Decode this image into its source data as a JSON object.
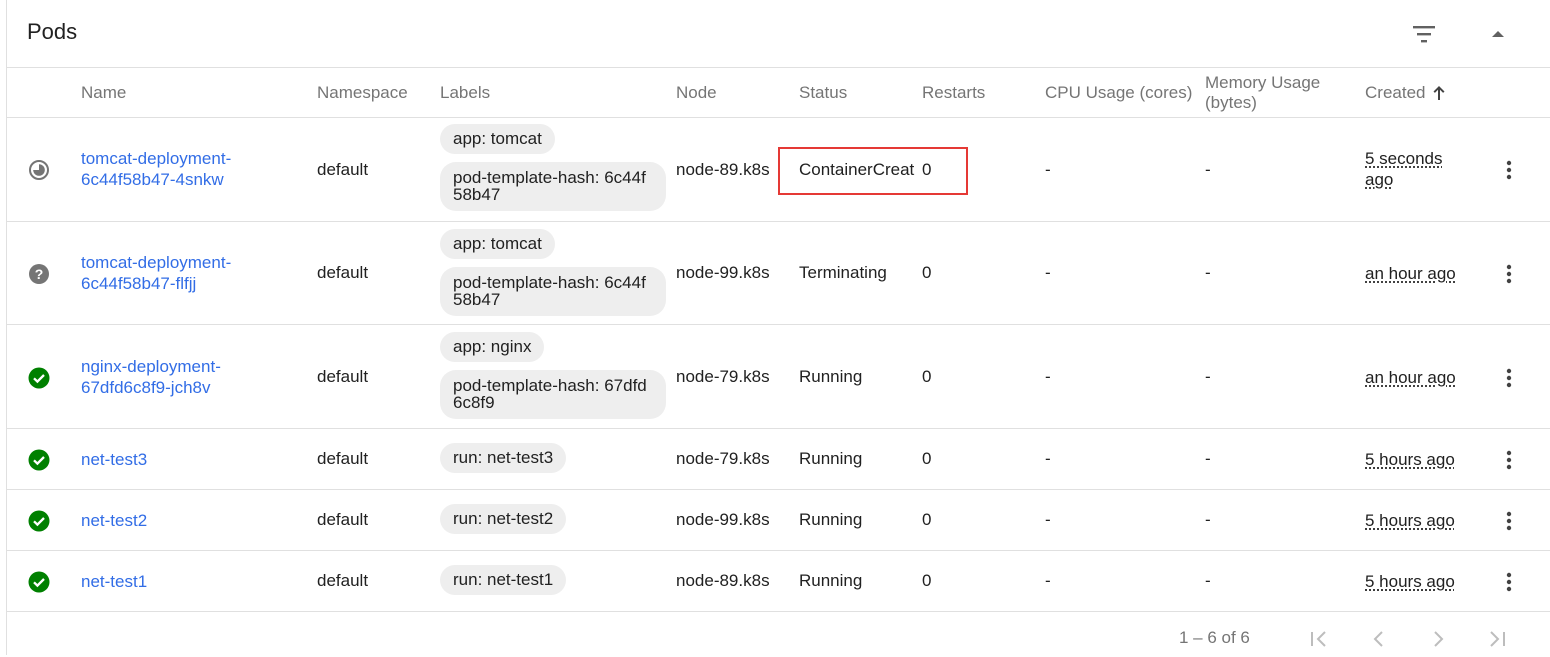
{
  "header": {
    "title": "Pods"
  },
  "columns": {
    "name": "Name",
    "namespace": "Namespace",
    "labels": "Labels",
    "node": "Node",
    "status": "Status",
    "restarts": "Restarts",
    "cpu": "CPU Usage (cores)",
    "memory_line1": "Memory Usage",
    "memory_line2": "(bytes)",
    "created": "Created",
    "created_sort_icon": "arrow-up-icon"
  },
  "rows": [
    {
      "status_icon": "pending-icon",
      "name_line1": "tomcat-deployment-",
      "name_line2": "6c44f58b47-4snkw",
      "namespace": "default",
      "labels": [
        "app: tomcat",
        "pod-template-hash: 6c44f58b47"
      ],
      "node": "node-89.k8s",
      "status": "ContainerCreat",
      "restarts": "0",
      "cpu": "-",
      "memory": "-",
      "created_line1": "5 seconds",
      "created_line2": "ago"
    },
    {
      "status_icon": "unknown-icon",
      "name_line1": "tomcat-deployment-",
      "name_line2": "6c44f58b47-flfjj",
      "namespace": "default",
      "labels": [
        "app: tomcat",
        "pod-template-hash: 6c44f58b47"
      ],
      "node": "node-99.k8s",
      "status": "Terminating",
      "restarts": "0",
      "cpu": "-",
      "memory": "-",
      "created_line1": "an hour ago",
      "created_line2": ""
    },
    {
      "status_icon": "check-circle-icon",
      "name_line1": "nginx-deployment-",
      "name_line2": "67dfd6c8f9-jch8v",
      "namespace": "default",
      "labels": [
        "app: nginx",
        "pod-template-hash: 67dfd6c8f9"
      ],
      "node": "node-79.k8s",
      "status": "Running",
      "restarts": "0",
      "cpu": "-",
      "memory": "-",
      "created_line1": "an hour ago",
      "created_line2": ""
    },
    {
      "status_icon": "check-circle-icon",
      "name_line1": "net-test3",
      "name_line2": "",
      "namespace": "default",
      "labels": [
        "run: net-test3"
      ],
      "node": "node-79.k8s",
      "status": "Running",
      "restarts": "0",
      "cpu": "-",
      "memory": "-",
      "created_line1": "5 hours ago",
      "created_line2": ""
    },
    {
      "status_icon": "check-circle-icon",
      "name_line1": "net-test2",
      "name_line2": "",
      "namespace": "default",
      "labels": [
        "run: net-test2"
      ],
      "node": "node-99.k8s",
      "status": "Running",
      "restarts": "0",
      "cpu": "-",
      "memory": "-",
      "created_line1": "5 hours ago",
      "created_line2": ""
    },
    {
      "status_icon": "check-circle-icon",
      "name_line1": "net-test1",
      "name_line2": "",
      "namespace": "default",
      "labels": [
        "run: net-test1"
      ],
      "node": "node-89.k8s",
      "status": "Running",
      "restarts": "0",
      "cpu": "-",
      "memory": "-",
      "created_line1": "5 hours ago",
      "created_line2": ""
    }
  ],
  "pagination": {
    "range": "1 – 6 of 6"
  },
  "colors": {
    "link": "#326de6",
    "running": "#008000",
    "unknown": "#757575",
    "highlight": "#e53935"
  }
}
